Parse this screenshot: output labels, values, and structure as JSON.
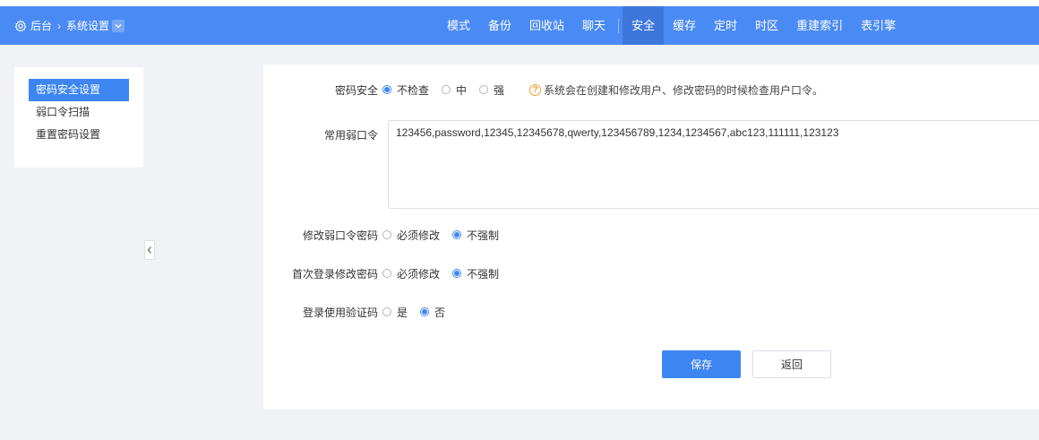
{
  "header": {
    "breadcrumb": {
      "root": "后台",
      "current": "系统设置"
    },
    "nav": [
      {
        "label": "模式"
      },
      {
        "label": "备份"
      },
      {
        "label": "回收站"
      },
      {
        "label": "聊天"
      },
      {
        "label": "安全",
        "active": true
      },
      {
        "label": "缓存"
      },
      {
        "label": "定时"
      },
      {
        "label": "时区"
      },
      {
        "label": "重建索引"
      },
      {
        "label": "表引擎"
      }
    ]
  },
  "sidebar": {
    "items": [
      {
        "label": "密码安全设置",
        "active": true
      },
      {
        "label": "弱口令扫描"
      },
      {
        "label": "重置密码设置"
      }
    ]
  },
  "form": {
    "password_strength": {
      "label": "密码安全",
      "options": [
        "不检查",
        "中",
        "强"
      ],
      "selected": "不检查",
      "hint": "系统会在创建和修改用户、修改密码的时候检查用户口令。"
    },
    "weak_passwords": {
      "label": "常用弱口令",
      "value": "123456,password,12345,12345678,qwerty,123456789,1234,1234567,abc123,111111,123123"
    },
    "change_weak": {
      "label": "修改弱口令密码",
      "options": [
        "必须修改",
        "不强制"
      ],
      "selected": "不强制"
    },
    "first_login": {
      "label": "首次登录修改密码",
      "options": [
        "必须修改",
        "不强制"
      ],
      "selected": "不强制"
    },
    "captcha": {
      "label": "登录使用验证码",
      "options": [
        "是",
        "否"
      ],
      "selected": "否"
    },
    "save_label": "保存",
    "back_label": "返回"
  },
  "colors": {
    "topbar": "#4a8af4",
    "nav_active": "#3d77dc",
    "accent": "#3d86f2",
    "background": "#f0f2f5",
    "hint_icon": "#f0a02c"
  }
}
